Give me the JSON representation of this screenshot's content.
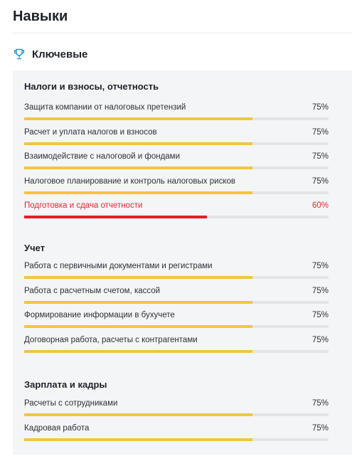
{
  "page": {
    "title": "Навыки"
  },
  "key_section": {
    "title": "Ключевые",
    "icon": "trophy-icon"
  },
  "colors": {
    "bar_normal": "#f2c541",
    "bar_alert": "#e31d2a",
    "track": "#e2e4e8",
    "alert_text": "#e32a32"
  },
  "groups": [
    {
      "title": "Налоги и взносы, отчетность",
      "skills": [
        {
          "name": "Защита компании от налоговых претензий",
          "percent_label": "75%",
          "value": 75,
          "alert": false
        },
        {
          "name": "Расчет и уплата налогов и взносов",
          "percent_label": "75%",
          "value": 75,
          "alert": false
        },
        {
          "name": "Взаимодействие с налоговой и фондами",
          "percent_label": "75%",
          "value": 75,
          "alert": false
        },
        {
          "name": "Налоговое планирование и контроль налоговых рисков",
          "percent_label": "75%",
          "value": 75,
          "alert": false
        },
        {
          "name": "Подготовка и сдача отчетности",
          "percent_label": "60%",
          "value": 60,
          "alert": true
        }
      ]
    },
    {
      "title": "Учет",
      "skills": [
        {
          "name": "Работа с первичными документами и регистрами",
          "percent_label": "75%",
          "value": 75,
          "alert": false
        },
        {
          "name": "Работа с расчетным счетом, кассой",
          "percent_label": "75%",
          "value": 75,
          "alert": false
        },
        {
          "name": "Формирование информации в бухучете",
          "percent_label": "75%",
          "value": 75,
          "alert": false
        },
        {
          "name": "Договорная работа, расчеты с контрагентами",
          "percent_label": "75%",
          "value": 75,
          "alert": false
        }
      ]
    },
    {
      "title": "Зарплата и кадры",
      "skills": [
        {
          "name": "Расчеты с сотрудниками",
          "percent_label": "75%",
          "value": 75,
          "alert": false
        },
        {
          "name": "Кадровая работа",
          "percent_label": "75%",
          "value": 75,
          "alert": false
        }
      ]
    }
  ]
}
